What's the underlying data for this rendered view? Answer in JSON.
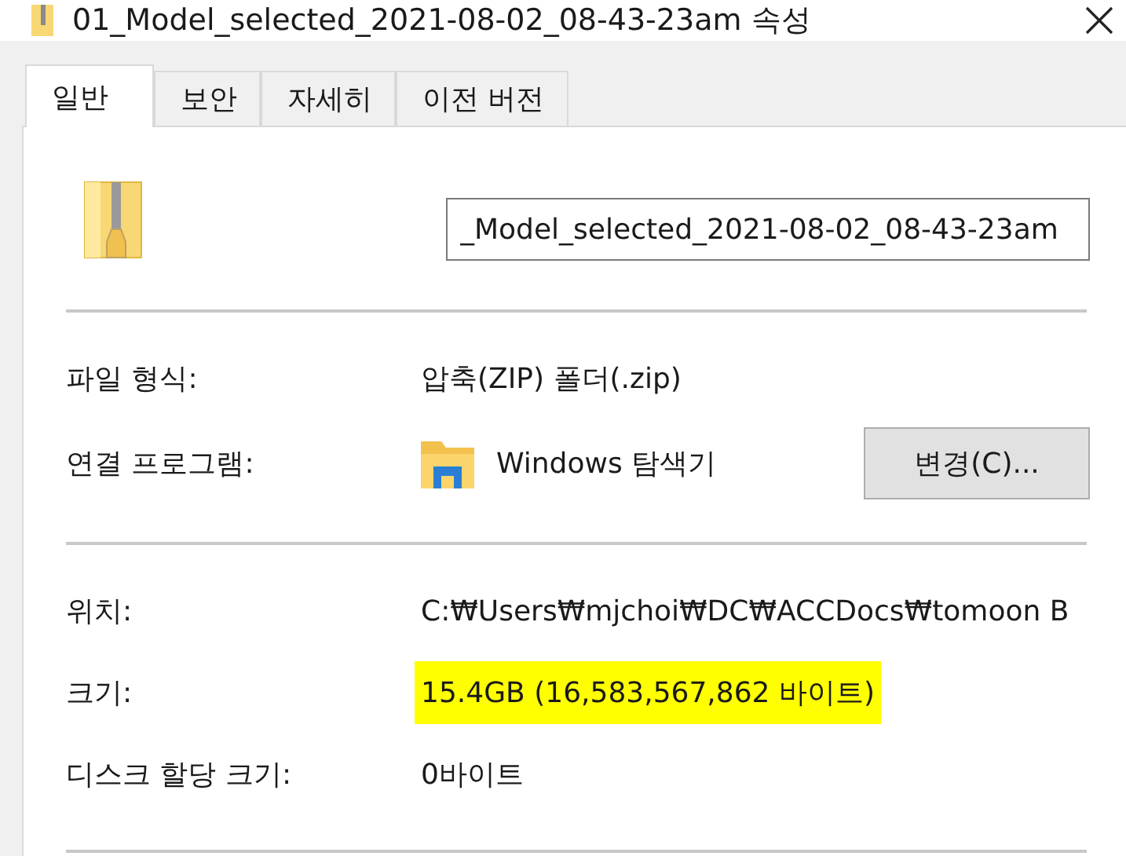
{
  "window": {
    "title": "01_Model_selected_2021-08-02_08-43-23am 속성"
  },
  "tabs": [
    {
      "label": "일반",
      "selected": true
    },
    {
      "label": "보안",
      "selected": false
    },
    {
      "label": "자세히",
      "selected": false
    },
    {
      "label": "이전 버전",
      "selected": false
    }
  ],
  "name_field": {
    "value": "_Model_selected_2021-08-02_08-43-23am"
  },
  "sections": [
    {
      "rows": [
        {
          "label": "파일 형식:",
          "value": "압축(ZIP) 폴더(.zip)"
        },
        {
          "label": "연결 프로그램:",
          "value": "Windows 탐색기",
          "kind": "program",
          "button": "변경(C)..."
        }
      ]
    },
    {
      "rows": [
        {
          "label": "위치:",
          "value": "C:₩Users₩mjchoi₩DC₩ACCDocs₩tomoon B"
        },
        {
          "label": "크기:",
          "value": "15.4GB (16,583,567,862 바이트)",
          "highlighted": true
        },
        {
          "label": "디스크 할당 크기:",
          "value": "0바이트"
        }
      ]
    }
  ]
}
